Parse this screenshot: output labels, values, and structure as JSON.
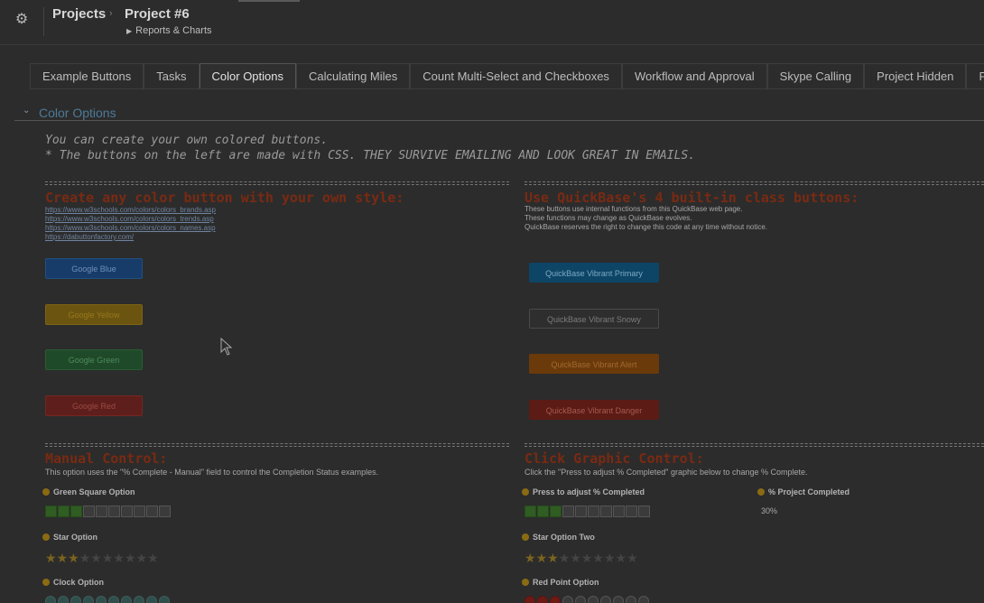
{
  "header": {
    "breadcrumb_root": "Projects",
    "breadcrumb_current": "Project #6",
    "sub_link": "Reports & Charts"
  },
  "tabs": [
    {
      "label": "Example Buttons"
    },
    {
      "label": "Tasks"
    },
    {
      "label": "Color Options",
      "active": true
    },
    {
      "label": "Calculating Miles"
    },
    {
      "label": "Count Multi-Select and Checkboxes"
    },
    {
      "label": "Workflow and Approval"
    },
    {
      "label": "Skype Calling"
    },
    {
      "label": "Project Hidden"
    },
    {
      "label": "Project S"
    }
  ],
  "section": {
    "title": "Color Options"
  },
  "intro": {
    "line1": "You can create your own colored buttons.",
    "line2": "* The buttons on the left are made with CSS. THEY SURVIVE EMAILING AND LOOK GREAT IN EMAILS."
  },
  "left": {
    "heading": "Create any color button with your own style:",
    "links": [
      "https://www.w3schools.com/colors/colors_brands.asp",
      "https://www.w3schools.com/colors/colors_trends.asp",
      "https://www.w3schools.com/colors/colors_names.asp",
      "https://dabuttonfactory.com/"
    ],
    "buttons": [
      {
        "label": "Google Blue",
        "bg": "#173c6a",
        "fg": "#6f8fb8",
        "border": "#22507f"
      },
      {
        "label": "Google Yellow",
        "bg": "#6b5410",
        "fg": "#97791d",
        "border": "#7d6413"
      },
      {
        "label": "Google Green",
        "bg": "#1f4a29",
        "fg": "#4e8a5c",
        "border": "#2a5b33"
      },
      {
        "label": "Google Red",
        "bg": "#5e1e1b",
        "fg": "#9a4a45",
        "border": "#742723"
      }
    ]
  },
  "right": {
    "heading": "Use QuickBase's 4 built-in class buttons:",
    "notes": [
      "These buttons use internal functions from this QuickBase web page.",
      "These functions may change as QuickBase evolves.",
      "QuickBase reserves the right to change this code at any time without notice."
    ],
    "buttons": [
      {
        "label": "QuickBase Vibrant Primary",
        "bg": "#0d4566",
        "fg": "#7fa9c4",
        "border": "#0d4566"
      },
      {
        "label": "QuickBase Vibrant Snowy",
        "bg": "#2e2e2e",
        "fg": "#7c7c7c",
        "border": "#4a4a4a"
      },
      {
        "label": "QuickBase Vibrant Alert",
        "bg": "#6b3a0b",
        "fg": "#a06a2e",
        "border": "#6b3a0b"
      },
      {
        "label": "QuickBase Vibrant Danger",
        "bg": "#5c1b15",
        "fg": "#a65b50",
        "border": "#5c1b15"
      }
    ]
  },
  "manual": {
    "heading": "Manual Control:",
    "desc": "This option uses the \"% Complete - Manual\" field to control the Completion Status examples.",
    "green_square_label": "Green Square Option",
    "green_square_value": 0.3,
    "star_label": "Star Option",
    "star_value": 3,
    "clock_label": "Clock Option"
  },
  "graphic": {
    "heading": "Click Graphic Control:",
    "desc": "Click the \"Press to adjust % Completed\" graphic below to change % Complete.",
    "press_label": "Press to adjust % Completed",
    "press_value": 0.3,
    "pct_label": "% Project Completed",
    "pct_value": "30%",
    "star2_label": "Star Option Two",
    "star2_value": 3,
    "redpoint_label": "Red Point Option",
    "redpoint_value": 3
  },
  "colors": {
    "heading": "#7a2a12",
    "link": "#6f84a0",
    "section_title": "#4d7a99"
  }
}
